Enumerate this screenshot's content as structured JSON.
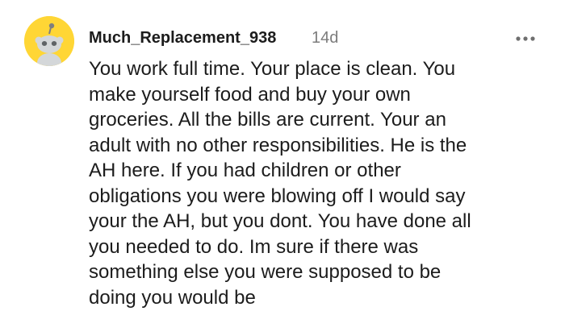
{
  "comment": {
    "author": "Much_Replacement_938",
    "age": "14d",
    "avatar_icon": "snoo-avatar-icon",
    "avatar_color": "#ffd635",
    "more_icon": "more-options-icon",
    "body": "You work full time. Your place is clean. You\nmake yourself food and buy your own\ngroceries. All the bills are current. Your an\nadult with no other responsibilities. He is the\nAH here. If you had children or other\nobligations you were blowing off I would say\nyour the AH, but you dont. You have done all\nyou needed to do. Im sure if there was\nsomething else you were supposed to be\ndoing you would be"
  }
}
